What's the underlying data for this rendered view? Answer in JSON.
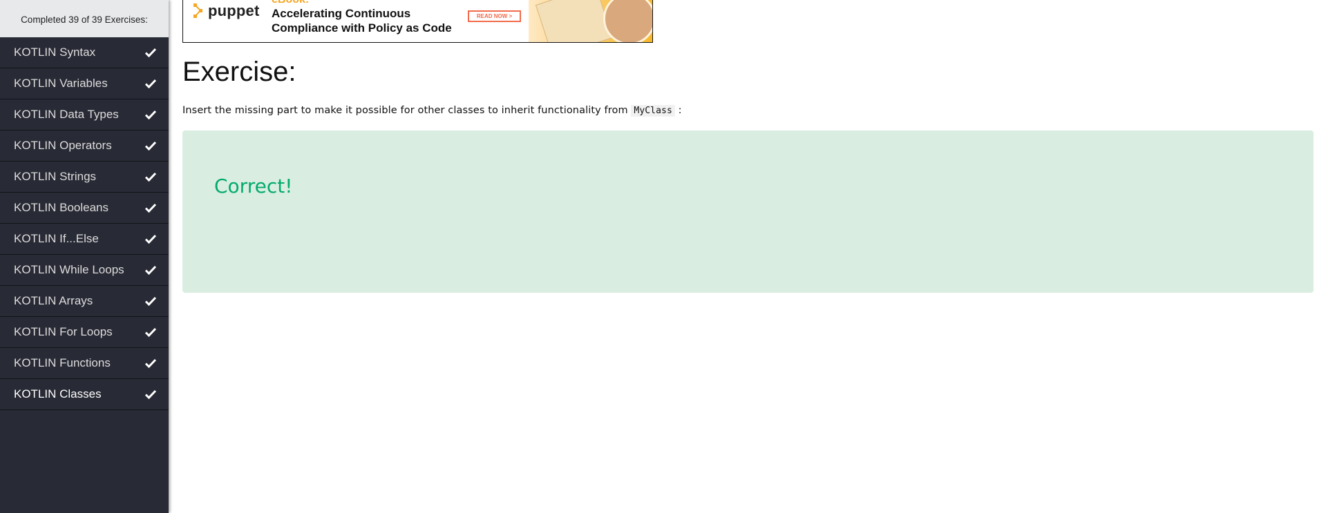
{
  "sidebar": {
    "progress_text": "Completed 39 of 39 Exercises:",
    "items": [
      {
        "label": "KOTLIN Syntax",
        "icon": "check-icon"
      },
      {
        "label": "KOTLIN Variables",
        "icon": "check-icon"
      },
      {
        "label": "KOTLIN Data Types",
        "icon": "check-icon"
      },
      {
        "label": "KOTLIN Operators",
        "icon": "check-icon"
      },
      {
        "label": "KOTLIN Strings",
        "icon": "check-icon"
      },
      {
        "label": "KOTLIN Booleans",
        "icon": "check-icon"
      },
      {
        "label": "KOTLIN If...Else",
        "icon": "check-icon"
      },
      {
        "label": "KOTLIN While Loops",
        "icon": "check-icon"
      },
      {
        "label": "KOTLIN Arrays",
        "icon": "check-icon"
      },
      {
        "label": "KOTLIN For Loops",
        "icon": "check-icon"
      },
      {
        "label": "KOTLIN Functions",
        "icon": "check-icon"
      },
      {
        "label": "KOTLIN Classes",
        "icon": "check-icon"
      }
    ],
    "active_index": 11
  },
  "banner": {
    "brand": "puppet",
    "eyebrow": "eBook:",
    "headline_line1": "Accelerating Continuous",
    "headline_line2": "Compliance with Policy as Code",
    "cta": "READ NOW >"
  },
  "main": {
    "title": "Exercise:",
    "instruction_prefix": "Insert the missing part to make it possible for other classes to inherit functionality from",
    "instruction_code": "MyClass",
    "instruction_suffix": ":",
    "result": "Correct!"
  },
  "colors": {
    "sidebar_bg": "#282a35",
    "success_bg": "#d9eee1",
    "success_text": "#04aa6d"
  }
}
